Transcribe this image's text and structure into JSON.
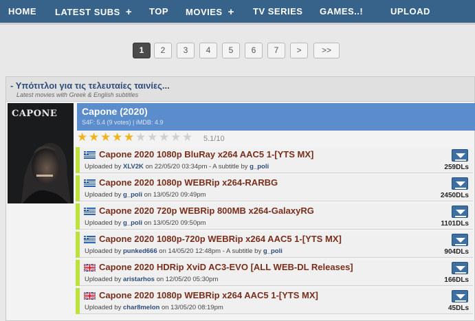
{
  "nav": {
    "items": [
      {
        "label": "HOME",
        "plus": ""
      },
      {
        "label": "LATEST SUBS",
        "plus": "+"
      },
      {
        "label": "TOP",
        "plus": ""
      },
      {
        "label": "MOVIES",
        "plus": "+"
      },
      {
        "label": "TV SERIES",
        "plus": ""
      },
      {
        "label": "GAMES..!",
        "plus": ""
      },
      {
        "label": "UPLOAD",
        "plus": ""
      }
    ]
  },
  "pagination": {
    "pages": [
      "1",
      "2",
      "3",
      "4",
      "5",
      "6",
      "7",
      ">",
      ">>"
    ],
    "active": "1"
  },
  "panel": {
    "title": "- Υπότιτλοι για τις τελευταίες ταινίες...",
    "subtitle": "Latest movies with Greek & English subtitles"
  },
  "movie": {
    "poster_text": "CAPONE",
    "title": "Capone (2020)",
    "meta": "S4F: 5.4 (9 votes) | iMDB: 4.9",
    "stars_filled": 5,
    "stars_total": 10,
    "rating_label": "5.1/10"
  },
  "subtitles": [
    {
      "flag": "gr",
      "title": "Capone 2020 1080p BluRay x264 AAC5 1-[YTS MX]",
      "uploaded_prefix": "Uploaded by",
      "uploader": "XLV2K",
      "on_text": "on 22/05/20 03:34pm - A subtitle by",
      "author": "g_poli",
      "dls": "259DLs"
    },
    {
      "flag": "gr",
      "title": "Capone 2020 1080p WEBRip x264-RARBG",
      "uploaded_prefix": "Uploaded by",
      "uploader": "g_poli",
      "on_text": "on 13/05/20 09:49pm",
      "author": "",
      "dls": "2450DLs"
    },
    {
      "flag": "gr",
      "title": "Capone 2020 720p WEBRip 800MB x264-GalaxyRG",
      "uploaded_prefix": "Uploaded by",
      "uploader": "g_poli",
      "on_text": "on 13/05/20 09:50pm",
      "author": "",
      "dls": "1101DLs"
    },
    {
      "flag": "gr",
      "title": "Capone 2020 1080p-720p WEBRip x264 AAC5 1-[YTS MX]",
      "uploaded_prefix": "Uploaded by",
      "uploader": "punked666",
      "on_text": "on 14/05/20 12:48pm - A subtitle by",
      "author": "g_poli",
      "dls": "904DLs"
    },
    {
      "flag": "en",
      "title": "Capone 2020 HDRip XviD AC3-EVO [ALL WEB-DL Releases]",
      "uploaded_prefix": "Uploaded by",
      "uploader": "aristarhos",
      "on_text": "on 12/05/20 05:30pm",
      "author": "",
      "dls": "166DLs"
    },
    {
      "flag": "en",
      "title": "Capone 2020 1080p WEBRip x264 AAC5 1-[YTS MX]",
      "uploaded_prefix": "Uploaded by",
      "uploader": "char8melon",
      "on_text": "on 13/05/20 08:19pm",
      "author": "",
      "dls": "45DLs"
    }
  ],
  "colors": {
    "nav_bg": "#37628a",
    "movie_head_bg": "#5b8ccc",
    "row_accent": "#bde13f",
    "title_text": "#7a2e1a",
    "user_text": "#2d4c7a",
    "star_filled": "#f2b21a",
    "star_empty": "#d0d0d0"
  },
  "icons": {
    "download": "download-arrow-icon",
    "flag_gr": "greek-flag-icon",
    "flag_en": "uk-flag-icon",
    "star": "star-icon"
  }
}
